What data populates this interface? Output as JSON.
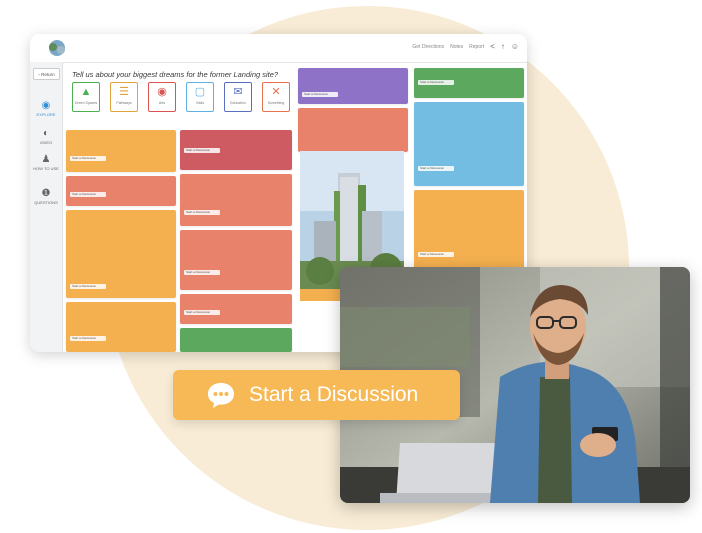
{
  "app": {
    "question": "Tell us about your biggest dreams for the former Landing site?",
    "return_label": "Return",
    "topbar": {
      "links": [
        "Get Directions",
        "Notes",
        "Report"
      ]
    },
    "sidebar": [
      {
        "label": "EXPLORE",
        "icon": "map-pin-icon",
        "active": true
      },
      {
        "label": "VIDEO",
        "icon": "globe-icon",
        "active": false
      },
      {
        "label": "HOW TO USE",
        "icon": "people-icon",
        "active": false
      },
      {
        "label": "QUESTIONS",
        "icon": "info-icon",
        "active": false
      }
    ],
    "categories": [
      {
        "label": "Green Spaces",
        "icon": "tree-icon",
        "color": "#4caf50"
      },
      {
        "label": "Pathways",
        "icon": "path-icon",
        "color": "#e0a43a"
      },
      {
        "label": "Arts",
        "icon": "palette-icon",
        "color": "#d9534f"
      },
      {
        "label": "Visits",
        "icon": "visit-icon",
        "color": "#5fb0e0"
      },
      {
        "label": "Education",
        "icon": "chat-icon",
        "color": "#5b6fbf"
      },
      {
        "label": "Something",
        "icon": "x-icon",
        "color": "#e57350"
      }
    ],
    "colors": {
      "orange": "#f4b04f",
      "salmon": "#e9826b",
      "red": "#cf5b62",
      "purple": "#8e72c8",
      "green": "#5ba85e",
      "blue": "#73bde3",
      "accent": "#f7b955"
    },
    "discussion_pill": "Start a Discussion"
  },
  "cta": {
    "label": "Start a Discussion",
    "icon": "speech-bubble-icon"
  }
}
